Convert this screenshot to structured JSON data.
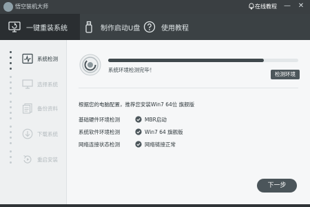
{
  "window": {
    "title": "悟空装机大师",
    "online_label": "在线教程",
    "minimize_symbol": "—",
    "close_symbol": "✕"
  },
  "toolbar": {
    "tabs": [
      {
        "label": "一键重装系统",
        "icon": "monitor-refresh-icon",
        "active": true
      },
      {
        "label": "制作启动U盘",
        "icon": "usb-drive-icon",
        "active": false
      },
      {
        "label": "使用教程",
        "icon": "help-circle-icon",
        "active": false
      }
    ]
  },
  "sidebar": {
    "steps": [
      {
        "label": "系统检测",
        "icon": "pulse-monitor-icon",
        "active": true
      },
      {
        "label": "选择系统",
        "icon": "monitor-icon",
        "active": false
      },
      {
        "label": "备份资料",
        "icon": "documents-icon",
        "active": false
      },
      {
        "label": "下载系统",
        "icon": "download-icon",
        "active": false
      },
      {
        "label": "重启安装",
        "icon": "restart-icon",
        "active": false
      }
    ]
  },
  "main": {
    "progress": 0.82,
    "status_text": "系统环境检测完毕！",
    "check_button": "检测环境",
    "recommendation": "根据您的电脑配置，推荐您安装Win7 64位 旗舰版",
    "rows": [
      {
        "label": "基础硬件环境检测",
        "value": "MBR启动"
      },
      {
        "label": "系统软件环境检测",
        "value": "Win7 64 旗舰版"
      },
      {
        "label": "网络连接状态检测",
        "value": "网络链接正常"
      }
    ],
    "next_button": "下一步"
  },
  "colors": {
    "titlebar": "#3a3f42",
    "toolbar": "#3b4144",
    "active_tab": "#2a2e31",
    "accent_dark": "#4b555a",
    "background": "#f4f5f6"
  }
}
